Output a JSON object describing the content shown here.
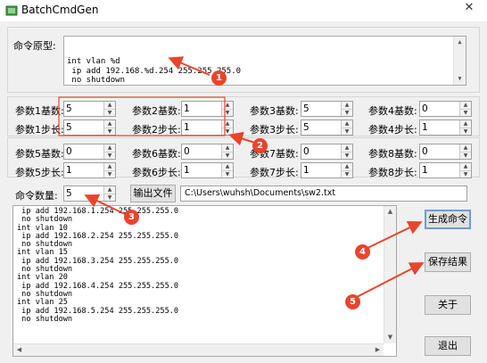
{
  "window": {
    "title": "BatchCmdGen",
    "close_glyph": "✕"
  },
  "prototype": {
    "label": "命令原型:",
    "text": "int vlan %d\n ip add 192.168.%d.254 255.255.255.0\n no shutdown"
  },
  "params": {
    "row1": [
      {
        "label": "参数1基数:",
        "value": "5"
      },
      {
        "label": "参数2基数:",
        "value": "1"
      },
      {
        "label": "参数3基数:",
        "value": "5"
      },
      {
        "label": "参数4基数:",
        "value": "0"
      }
    ],
    "row2": [
      {
        "label": "参数1步长:",
        "value": "5"
      },
      {
        "label": "参数2步长:",
        "value": "1"
      },
      {
        "label": "参数3步长:",
        "value": "5"
      },
      {
        "label": "参数4步长:",
        "value": "1"
      }
    ],
    "row3": [
      {
        "label": "参数5基数:",
        "value": "0"
      },
      {
        "label": "参数6基数:",
        "value": "0"
      },
      {
        "label": "参数7基数:",
        "value": "0"
      },
      {
        "label": "参数8基数:",
        "value": "0"
      }
    ],
    "row4": [
      {
        "label": "参数5步长:",
        "value": "1"
      },
      {
        "label": "参数6步长:",
        "value": "1"
      },
      {
        "label": "参数7步长:",
        "value": "1"
      },
      {
        "label": "参数8步长:",
        "value": "1"
      }
    ]
  },
  "count": {
    "label": "命令数量:",
    "value": "5"
  },
  "export": {
    "button_label": "输出文件",
    "path": "C:\\Users\\wuhsh\\Documents\\sw2.txt"
  },
  "output": {
    "text": " ip add 192.168.1.254 255.255.255.0\n no shutdown\nint vlan 10\n ip add 192.168.2.254 255.255.255.0\n no shutdown\nint vlan 15\n ip add 192.168.3.254 255.255.255.0\n no shutdown\nint vlan 20\n ip add 192.168.4.254 255.255.255.0\n no shutdown\nint vlan 25\n ip add 192.168.5.254 255.255.255.0\n no shutdown"
  },
  "buttons": {
    "generate": "生成命令",
    "save": "保存结果",
    "about": "关于",
    "exit": "退出"
  },
  "annotations": {
    "color": "#e8452c",
    "badges": [
      "1",
      "2",
      "3",
      "4",
      "5"
    ]
  }
}
